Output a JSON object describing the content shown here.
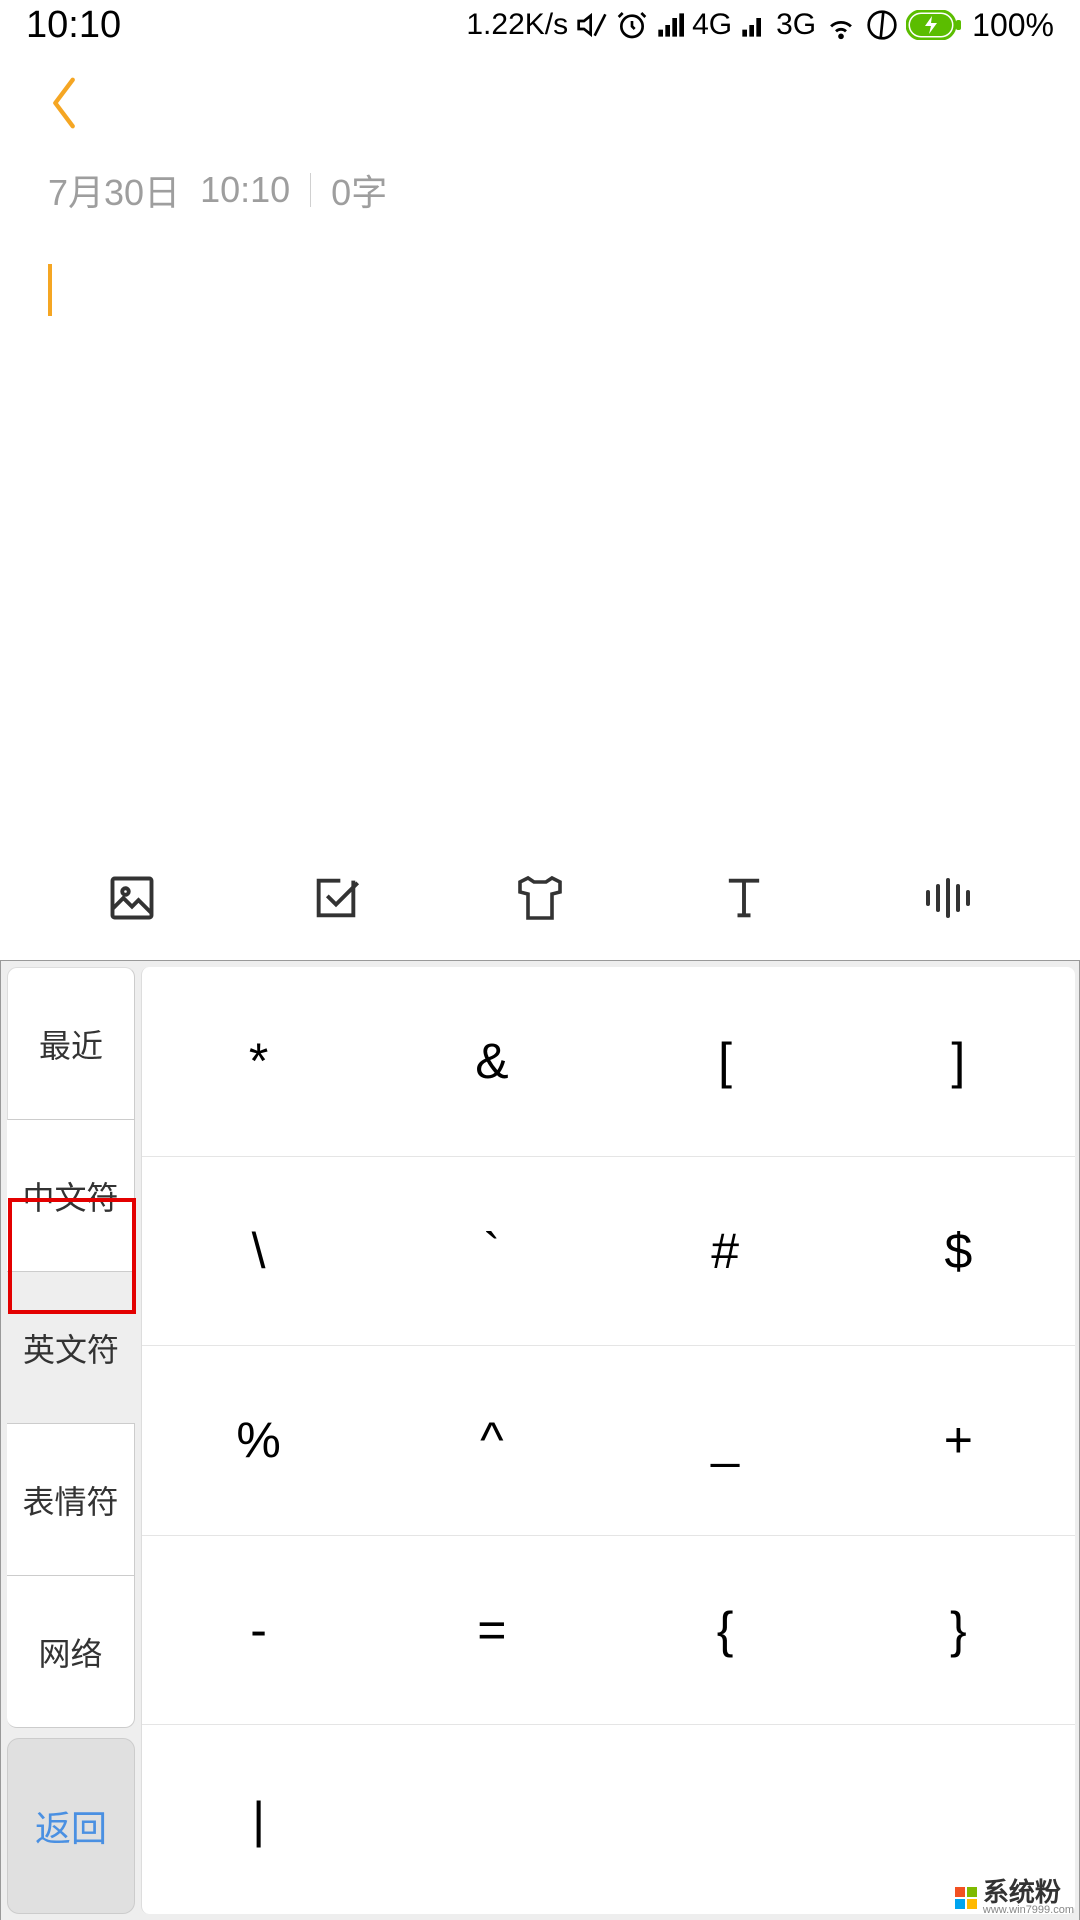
{
  "status": {
    "time": "10:10",
    "speed": "1.22K/s",
    "net1": "4G",
    "net2": "3G",
    "battery_pct": "100%"
  },
  "meta": {
    "date": "7月30日",
    "time": "10:10",
    "word_count": "0字"
  },
  "keyboard": {
    "tabs": [
      "最近",
      "中文符",
      "英文符",
      "表情符",
      "网络"
    ],
    "return_label": "返回",
    "rows": [
      [
        "*",
        "&",
        "[",
        "]"
      ],
      [
        "\\",
        "`",
        "#",
        "$"
      ],
      [
        "%",
        "^",
        "_",
        "+"
      ],
      [
        "-",
        "=",
        "{",
        "}"
      ],
      [
        "|",
        "",
        "",
        ""
      ]
    ]
  },
  "watermark": {
    "main": "系统粉",
    "sub": "www.win7999.com"
  }
}
